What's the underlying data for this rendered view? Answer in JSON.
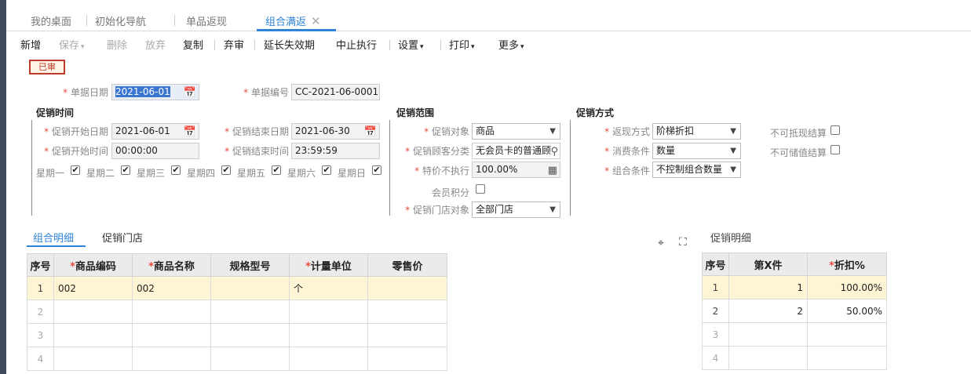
{
  "tabs": [
    "我的桌面",
    "初始化导航",
    "单品返现",
    "组合满返"
  ],
  "close_glyph": "✕",
  "toolbar": {
    "new": "新增",
    "save": "保存",
    "delete": "删除",
    "discard": "放弃",
    "copy": "复制",
    "unaudit": "弃审",
    "extend": "延长失效期",
    "stop": "中止执行",
    "settings": "设置",
    "print": "打印",
    "more": "更多"
  },
  "status_badge": "已审",
  "header": {
    "date_label": "单据日期",
    "date_value": "2021-06-01",
    "code_label": "单据编号",
    "code_value": "CC-2021-06-0001"
  },
  "promo_time": {
    "title": "促销时间",
    "start_date_label": "促销开始日期",
    "start_date": "2021-06-01",
    "end_date_label": "促销结束日期",
    "end_date": "2021-06-30",
    "start_time_label": "促销开始时间",
    "start_time": "00:00:00",
    "end_time_label": "促销结束时间",
    "end_time": "23:59:59",
    "weekdays": [
      "星期一",
      "星期二",
      "星期三",
      "星期四",
      "星期五",
      "星期六",
      "星期日"
    ]
  },
  "promo_scope": {
    "title": "促销范围",
    "target_label": "促销对象",
    "target_value": "商品",
    "customer_label": "促销顾客分类",
    "customer_value": "无会员卡的普通顾",
    "special_label": "特价不执行",
    "special_value": "100.00%",
    "points_label": "会员积分",
    "store_label": "促销门店对象",
    "store_value": "全部门店"
  },
  "promo_method": {
    "title": "促销方式",
    "rebate_label": "返现方式",
    "rebate_value": "阶梯折扣",
    "condition_label": "消费条件",
    "condition_value": "数量",
    "combo_label": "组合条件",
    "combo_value": "不控制组合数量",
    "no_offset_label": "不可抵现结算",
    "no_stored_label": "不可储值结算"
  },
  "detail_tabs": [
    "组合明细",
    "促销门店"
  ],
  "detail_table": {
    "headers": [
      "序号",
      "商品编码",
      "商品名称",
      "规格型号",
      "计量单位",
      "零售价"
    ],
    "rows": [
      [
        "1",
        "002",
        "002",
        "",
        "个",
        ""
      ],
      [
        "2",
        "",
        "",
        "",
        "",
        ""
      ],
      [
        "3",
        "",
        "",
        "",
        "",
        ""
      ],
      [
        "4",
        "",
        "",
        "",
        "",
        ""
      ]
    ]
  },
  "promo_detail": {
    "title": "促销明细",
    "headers": [
      "序号",
      "第X件",
      "折扣%"
    ],
    "rows": [
      [
        "1",
        "1",
        "100.00%"
      ],
      [
        "2",
        "2",
        "50.00%"
      ],
      [
        "3",
        "",
        ""
      ],
      [
        "4",
        "",
        ""
      ]
    ]
  },
  "colors": {
    "accent": "#2f84d8",
    "required": "#e74c3c",
    "badge": "#c0392b",
    "highlight_row": "#fdf5d3"
  }
}
